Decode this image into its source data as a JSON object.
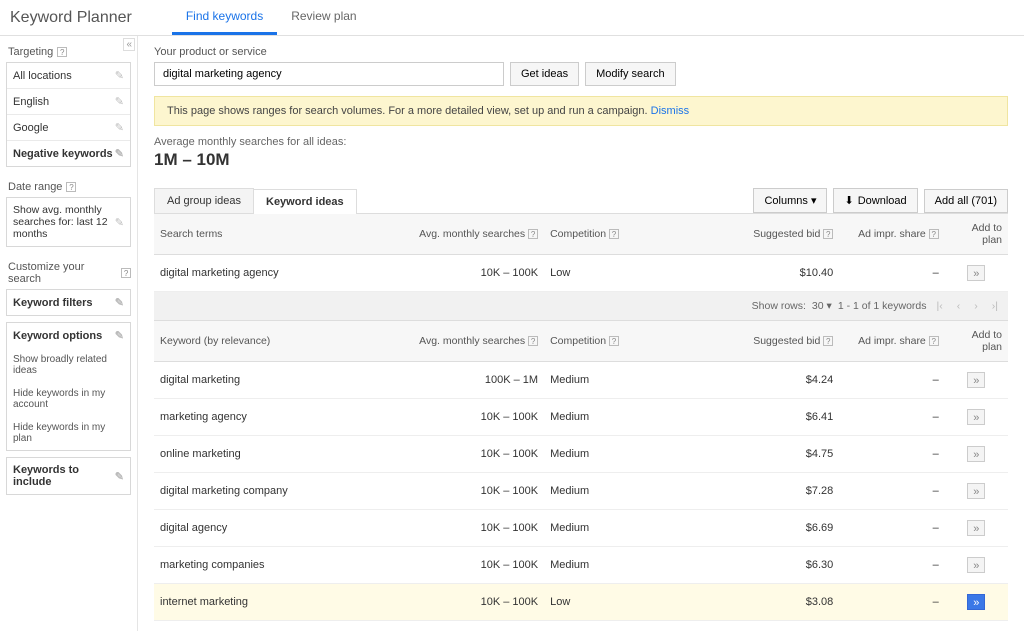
{
  "header": {
    "title": "Keyword Planner",
    "tabs": {
      "find": "Find keywords",
      "review": "Review plan"
    }
  },
  "sidebar": {
    "targeting": {
      "title": "Targeting",
      "locations": "All locations",
      "language": "English",
      "network": "Google",
      "negative": "Negative keywords"
    },
    "daterange": {
      "title": "Date range",
      "text": "Show avg. monthly searches for: last 12 months"
    },
    "customize": {
      "title": "Customize your search",
      "filters": "Keyword filters",
      "options_title": "Keyword options",
      "opt1": "Show broadly related ideas",
      "opt2": "Hide keywords in my account",
      "opt3": "Hide keywords in my plan",
      "include": "Keywords to include"
    }
  },
  "form": {
    "label": "Your product or service",
    "value": "digital marketing agency",
    "get_ideas": "Get ideas",
    "modify": "Modify search"
  },
  "notice": {
    "text": "This page shows ranges for search volumes. For a more detailed view, set up and run a campaign. ",
    "dismiss": "Dismiss"
  },
  "summary": {
    "label": "Average monthly searches for all ideas:",
    "value": "1M – 10M"
  },
  "tabs": {
    "adgroup": "Ad group ideas",
    "keyword": "Keyword ideas"
  },
  "actions": {
    "columns": "Columns",
    "download": "Download",
    "addall": "Add all (701)"
  },
  "cols": {
    "search_terms": "Search terms",
    "keyword_rel": "Keyword (by relevance)",
    "avg": "Avg. monthly searches",
    "comp": "Competition",
    "bid": "Suggested bid",
    "impr": "Ad impr. share",
    "addplan": "Add to plan"
  },
  "pager": {
    "showrows": "Show rows:",
    "rows": "30",
    "range": "1 - 1 of 1 keywords"
  },
  "search_terms": [
    {
      "term": "digital marketing agency",
      "avg": "10K – 100K",
      "comp": "Low",
      "bid": "$10.40",
      "impr": "–"
    }
  ],
  "keywords": [
    {
      "term": "digital marketing",
      "avg": "100K – 1M",
      "comp": "Medium",
      "bid": "$4.24",
      "impr": "–",
      "hl": false
    },
    {
      "term": "marketing agency",
      "avg": "10K – 100K",
      "comp": "Medium",
      "bid": "$6.41",
      "impr": "–",
      "hl": false
    },
    {
      "term": "online marketing",
      "avg": "10K – 100K",
      "comp": "Medium",
      "bid": "$4.75",
      "impr": "–",
      "hl": false
    },
    {
      "term": "digital marketing company",
      "avg": "10K – 100K",
      "comp": "Medium",
      "bid": "$7.28",
      "impr": "–",
      "hl": false
    },
    {
      "term": "digital agency",
      "avg": "10K – 100K",
      "comp": "Medium",
      "bid": "$6.69",
      "impr": "–",
      "hl": false
    },
    {
      "term": "marketing companies",
      "avg": "10K – 100K",
      "comp": "Medium",
      "bid": "$6.30",
      "impr": "–",
      "hl": false
    },
    {
      "term": "internet marketing",
      "avg": "10K – 100K",
      "comp": "Low",
      "bid": "$3.08",
      "impr": "–",
      "hl": true
    }
  ]
}
